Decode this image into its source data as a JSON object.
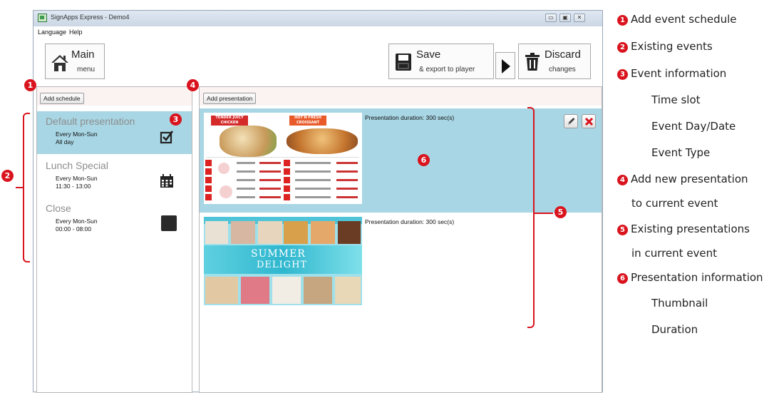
{
  "window": {
    "title": "SignApps Express - Demo4",
    "controls": [
      "▭",
      "▣",
      "✕"
    ]
  },
  "menubar": [
    "Language",
    "Help"
  ],
  "toolbar": {
    "main_line1": "Main",
    "main_line2": "menu",
    "save_line1": "Save",
    "save_line2": "& export to player",
    "discard_line1": "Discard",
    "discard_line2": "changes"
  },
  "schedule_panel": {
    "add_label": "Add schedule",
    "events": [
      {
        "name": "Default presentation",
        "days": "Every Mon-Sun",
        "time": "All day",
        "type_icon": "checkbox-icon",
        "selected": true
      },
      {
        "name": "Lunch Special",
        "days": "Every Mon-Sun",
        "time": "11:30 - 13:00",
        "type_icon": "calendar-icon",
        "selected": false
      },
      {
        "name": "Close",
        "days": "Every Mon-Sun",
        "time": "00:00 - 08:00",
        "type_icon": "black-square-icon",
        "selected": false
      }
    ]
  },
  "presentation_panel": {
    "add_label": "Add presentation",
    "items": [
      {
        "duration": "Presentation duration: 300 sec(s)",
        "selected": true
      },
      {
        "duration": "Presentation duration: 300 sec(s)",
        "selected": false
      }
    ],
    "thumb1": {
      "title_left": "TENDER JUICY CHICKEN",
      "title_right": "HOT'N FRESH CROISSANT",
      "numbers": [
        "1",
        "2",
        "3",
        "4",
        "5"
      ]
    },
    "thumb2": {
      "line1": "SUMMER",
      "line2": "DELIGHT"
    }
  },
  "callouts": [
    "1",
    "2",
    "3",
    "4",
    "5",
    "6"
  ],
  "legend": [
    {
      "num": "1",
      "text": "Add event schedule"
    },
    {
      "num": "2",
      "text": "Existing events"
    },
    {
      "num": "3",
      "text": "Event information"
    },
    {
      "sub": "Time slot"
    },
    {
      "sub": "Event Day/Date"
    },
    {
      "sub": "Event Type"
    },
    {
      "num": "4",
      "text": "Add new presentation"
    },
    {
      "cont": "to current event"
    },
    {
      "num": "5",
      "text": "Existing presentations"
    },
    {
      "cont": "in current event"
    },
    {
      "num": "6",
      "text": "Presentation information"
    },
    {
      "sub": "Thumbnail"
    },
    {
      "sub": "Duration"
    }
  ],
  "colors": {
    "accent": "#d9141e",
    "selected_row": "#a8d6e4"
  }
}
